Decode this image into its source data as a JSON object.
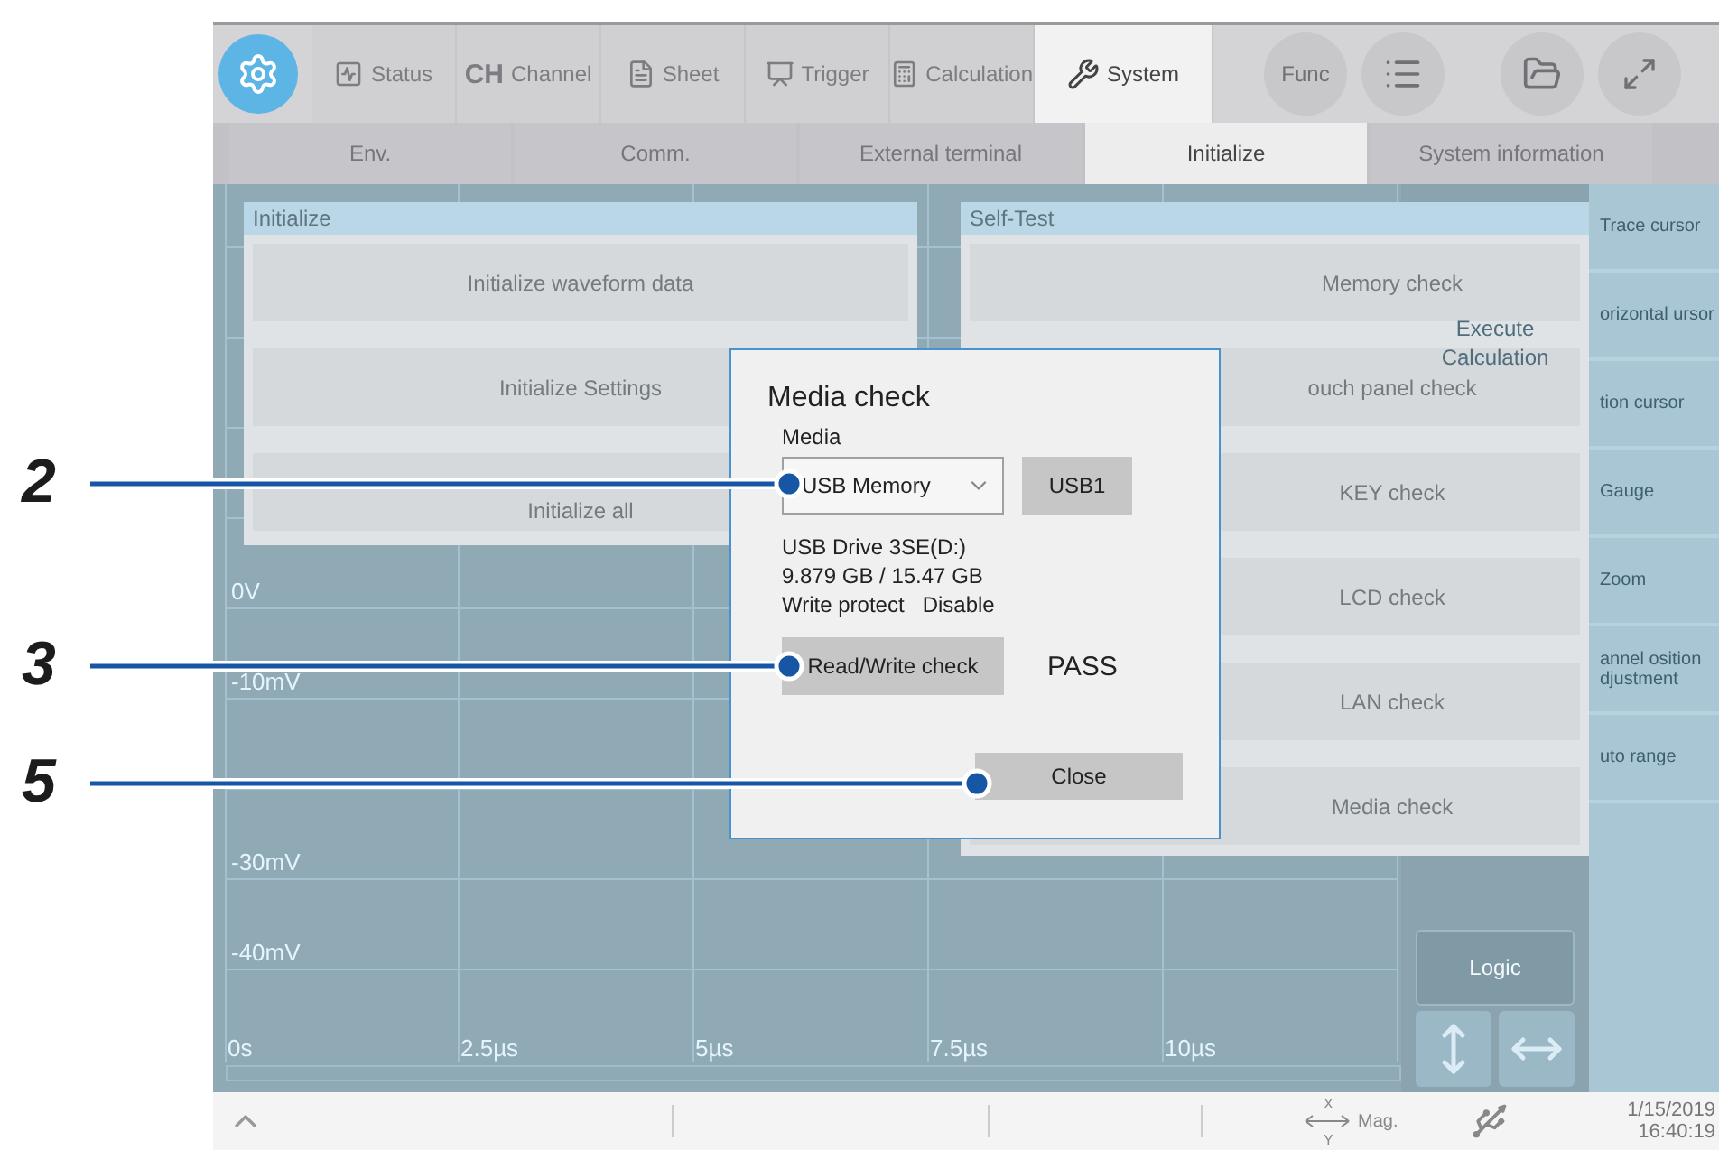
{
  "callouts": [
    {
      "number": "2"
    },
    {
      "number": "3"
    },
    {
      "number": "5"
    }
  ],
  "toolbar": {
    "tabs": [
      {
        "label": "Status",
        "selected": false
      },
      {
        "icon_text": "CH",
        "label": "Channel",
        "selected": false
      },
      {
        "label": "Sheet",
        "selected": false
      },
      {
        "label": "Trigger",
        "selected": false
      },
      {
        "label": "Calculation",
        "selected": false
      },
      {
        "label": "System",
        "selected": true
      }
    ],
    "round_buttons": [
      {
        "kind": "func",
        "label": "Func"
      },
      {
        "kind": "list"
      },
      {
        "kind": "folder"
      },
      {
        "kind": "expand"
      }
    ]
  },
  "subtabs": [
    {
      "label": "Env.",
      "selected": false
    },
    {
      "label": "Comm.",
      "selected": false
    },
    {
      "label": "External terminal",
      "selected": false
    },
    {
      "label": "Initialize",
      "selected": true
    },
    {
      "label": "System information",
      "selected": false
    }
  ],
  "scope": {
    "y_labels": [
      "0V",
      "-10mV",
      "-30mV",
      "-40mV"
    ],
    "x_labels": [
      "0s",
      "2.5µs",
      "5µs",
      "7.5µs",
      "10µs"
    ],
    "execute_button": "Execute Calculation",
    "logic_button": "Logic"
  },
  "side_panel": {
    "items": [
      "Trace cursor",
      "orizontal ursor",
      "tion cursor",
      "Gauge",
      "Zoom",
      "annel osition djustment",
      "uto range"
    ]
  },
  "initialize_panel": {
    "title": "Initialize",
    "buttons": [
      "Initialize waveform data",
      "Initialize Settings",
      "Initialize all"
    ]
  },
  "self_test_panel": {
    "title": "Self-Test",
    "buttons": [
      "Memory check",
      "ouch panel check",
      "KEY check",
      "LCD check",
      "LAN check",
      "Media check"
    ]
  },
  "media_dialog": {
    "title": "Media check",
    "media_label": "Media",
    "media_select": {
      "value": "USB Memory"
    },
    "port_button": "USB1",
    "drive_name": "USB Drive 3SE(D:)",
    "capacity": "9.879 GB / 15.47 GB",
    "write_protect_label": "Write protect",
    "write_protect_value": "Disable",
    "check_button": "Read/Write check",
    "result": "PASS",
    "close_button": "Close"
  },
  "status_bar": {
    "axis_x": "X",
    "axis_y": "Y",
    "mag": "Mag.",
    "date": "1/15/2019",
    "time": "16:40:19"
  }
}
